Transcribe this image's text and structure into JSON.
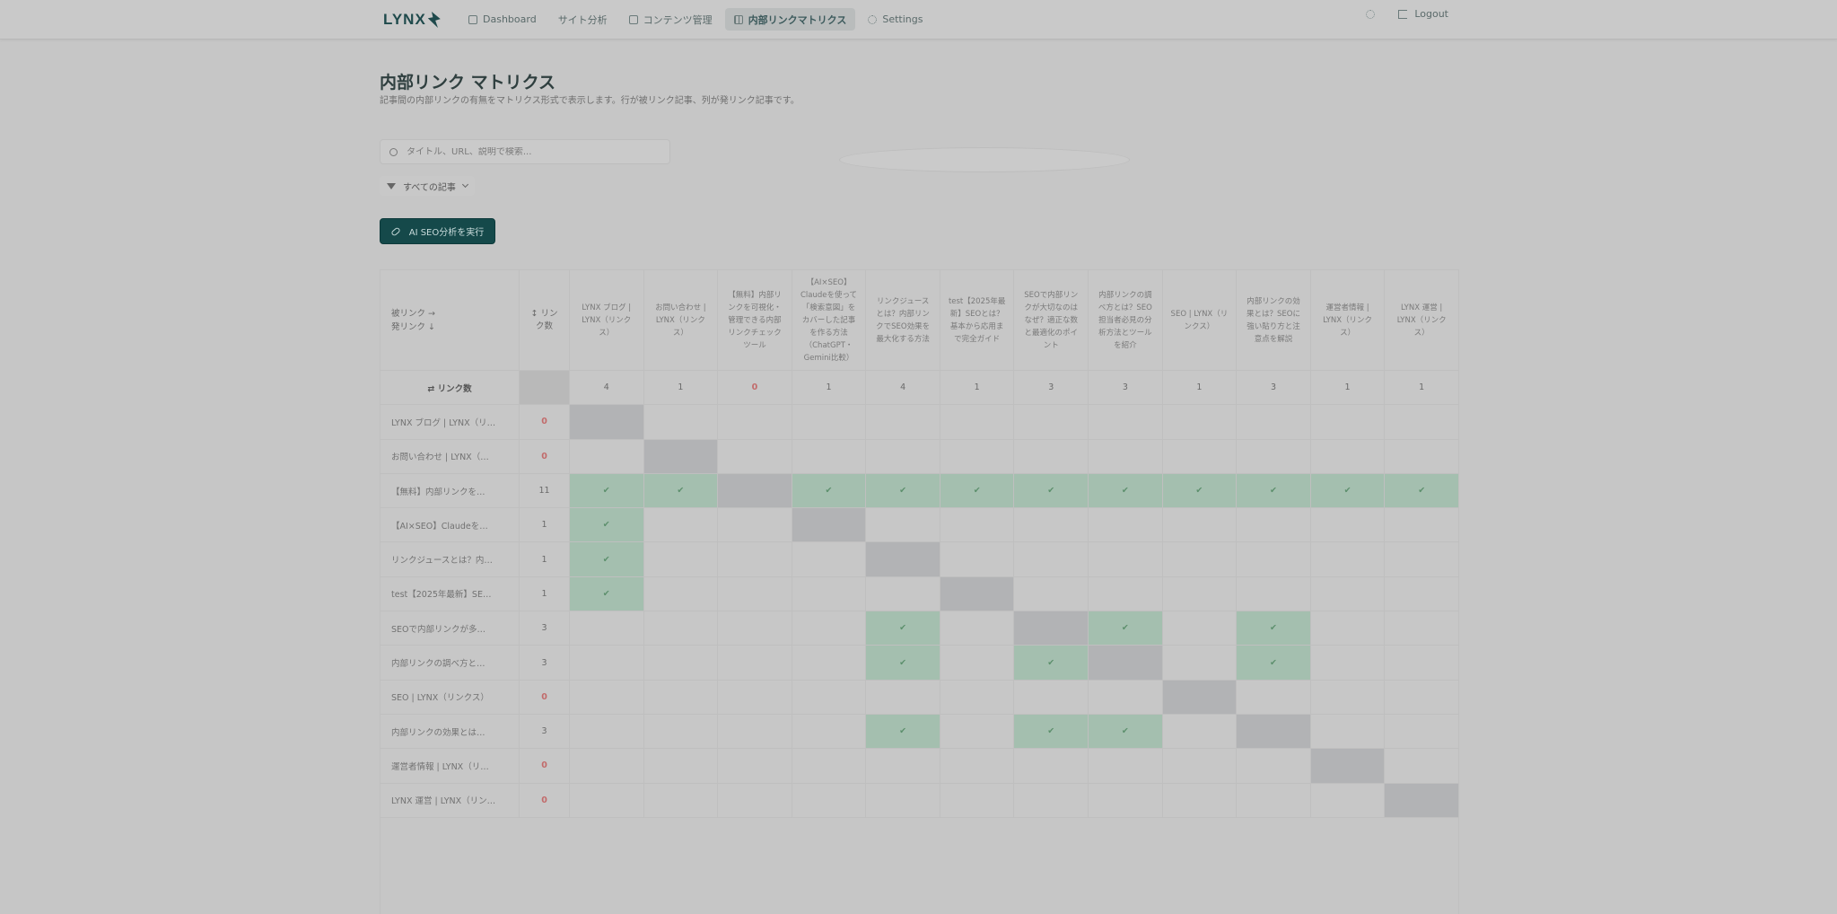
{
  "brand": {
    "name": "LYNX"
  },
  "nav": {
    "items": [
      {
        "label": "Dashboard",
        "icon": "dashboard-icon"
      },
      {
        "label": "サイト分析",
        "icon": "search-icon"
      },
      {
        "label": "コンテンツ管理",
        "icon": "document-icon"
      },
      {
        "label": "内部リンクマトリクス",
        "icon": "grid-icon"
      },
      {
        "label": "Settings",
        "icon": "gear-icon"
      }
    ],
    "active_index": 3,
    "logout": "Logout"
  },
  "page": {
    "title": "内部リンク マトリクス",
    "subtitle": "記事間の内部リンクの有無をマトリクス形式で表示します。行が被リンク記事、列が発リンク記事です。"
  },
  "search": {
    "placeholder": "タイトル、URL、説明で検索..."
  },
  "filter": {
    "label": "すべての記事"
  },
  "ai_button": {
    "label": "AI SEO分析を実行"
  },
  "matrix": {
    "corner_line1": "被リンク →",
    "corner_line2": "発リンク ↓",
    "count_header": "↕ リンク数",
    "total_label": "⇄ リンク数",
    "columns": [
      "LYNX ブログ | LYNX（リンクス）",
      "お問い合わせ | LYNX（リンクス）",
      "【無料】内部リンクを可視化・管理できる内部リンクチェックツール",
      "【AI×SEO】Claudeを使って「検索意図」をカバーした記事を作る方法（ChatGPT・Gemini比較）",
      "リンクジュースとは？内部リンクでSEO効果を最大化する方法",
      "test【2025年最新】SEOとは？基本から応用まで完全ガイド",
      "SEOで内部リンクが大切なのはなぜ？適正な数と最適化のポイント",
      "内部リンクの調べ方とは？SEO担当者必見の分析方法とツールを紹介",
      "SEO | LYNX（リンクス）",
      "内部リンクの効果とは？SEOに強い貼り方と注意点を解説",
      "運営者情報 | LYNX（リンクス）",
      "LYNX 運営 | LYNX（リンクス）"
    ],
    "column_totals": [
      "4",
      "1",
      "0",
      "1",
      "4",
      "1",
      "3",
      "3",
      "1",
      "3",
      "1",
      "1"
    ],
    "rows": [
      {
        "label": "LYNX ブログ | LYNX（リ…",
        "count": "0"
      },
      {
        "label": "お問い合わせ | LYNX（…",
        "count": "0"
      },
      {
        "label": "【無料】内部リンクを…",
        "count": "11"
      },
      {
        "label": "【AI×SEO】Claudeを…",
        "count": "1"
      },
      {
        "label": "リンクジュースとは？内…",
        "count": "1"
      },
      {
        "label": "test【2025年最新】SE…",
        "count": "1"
      },
      {
        "label": "SEOで内部リンクが多…",
        "count": "3"
      },
      {
        "label": "内部リンクの調べ方と…",
        "count": "3"
      },
      {
        "label": "SEO | LYNX（リンクス）",
        "count": "0"
      },
      {
        "label": "内部リンクの効果とは…",
        "count": "3"
      },
      {
        "label": "運営者情報 | LYNX（リ…",
        "count": "0"
      },
      {
        "label": "LYNX 運営 | LYNX（リン…",
        "count": "0"
      }
    ],
    "links": [
      [],
      [],
      [
        0,
        1,
        3,
        4,
        5,
        6,
        7,
        8,
        9,
        10,
        11
      ],
      [
        0
      ],
      [
        0
      ],
      [
        0
      ],
      [
        4,
        7,
        9
      ],
      [
        4,
        6,
        9
      ],
      [],
      [
        4,
        6,
        7
      ],
      [],
      []
    ],
    "check_glyph": "✔"
  }
}
